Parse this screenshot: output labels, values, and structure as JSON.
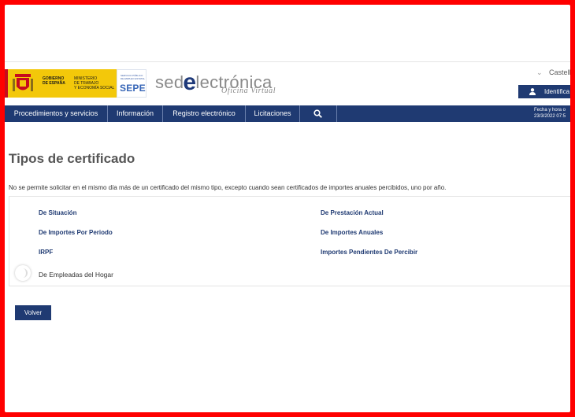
{
  "header": {
    "gov_text": "GOBIERNO\nDE ESPAÑA",
    "ministry_text": "MINISTERIO\nDE TRABAJO\nY ECONOMÍA SOCIAL",
    "sepe_small": "SERVICIO PÚBLICO\nDE EMPLEO ESTATAL",
    "sepe_big": "SEPE",
    "site_title_pre": "sed",
    "site_title_e": "e",
    "site_title_post": "lectrónica",
    "site_subtitle": "Oficina Virtual",
    "language": "Castell",
    "identify_label": "Identifica"
  },
  "nav": {
    "items": [
      "Procedimientos y servicios",
      "Información",
      "Registro electrónico",
      "Licitaciones"
    ],
    "fecha_label": "Fecha y hora o",
    "fecha_value": "23/3/2022 07:5"
  },
  "main": {
    "title": "Tipos de certificado",
    "intro": "No se permite solicitar en el mismo día más de un certificado del mismo tipo, excepto cuando sean certificados de importes anuales percibidos, uno por año.",
    "certificates_left": [
      "De Situación",
      "De Importes Por Periodo",
      "IRPF"
    ],
    "certificates_right": [
      "De Prestación Actual",
      "De Importes Anuales",
      "Importes Pendientes De Percibir"
    ],
    "certificate_last": "De Empleadas del Hogar",
    "back_button": "Volver"
  },
  "colors": {
    "frame": "#ff0000",
    "navy": "#1f3a72",
    "gov_yellow": "#f3c80a",
    "sepe_blue": "#3766b7"
  }
}
